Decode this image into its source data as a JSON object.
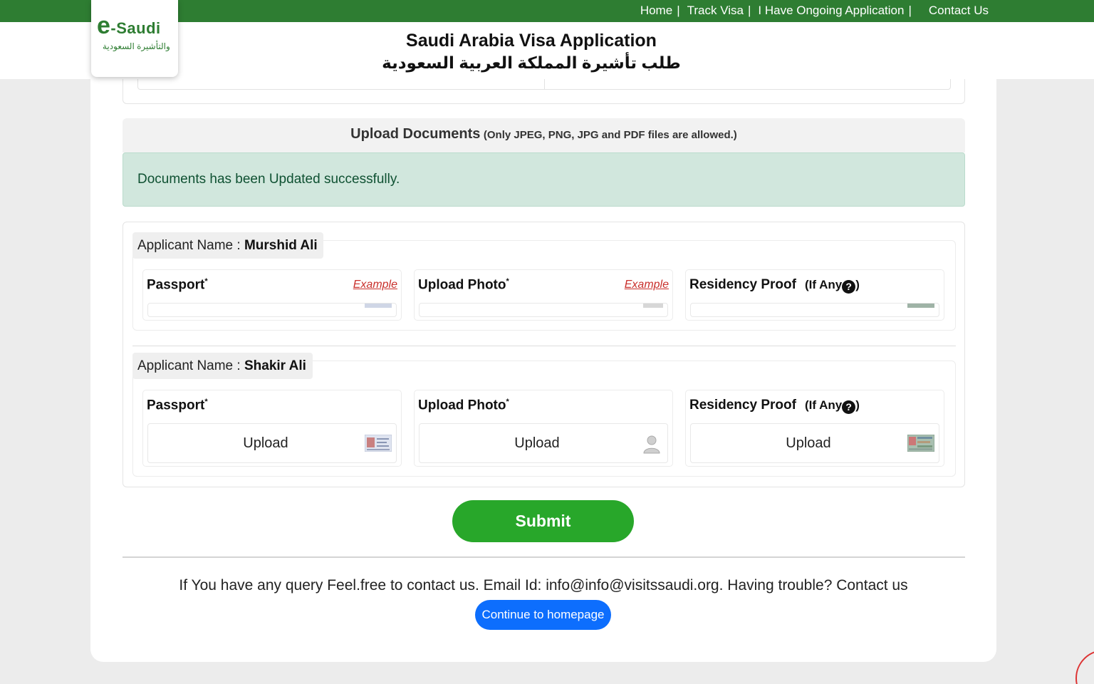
{
  "nav": {
    "home": "Home",
    "track": "Track Visa",
    "ongoing": "I Have Ongoing Application",
    "contact": "Contact Us",
    "sep": "|"
  },
  "logo": {
    "e": "e",
    "text": "-Saudi",
    "arabic": "والتأشيرة السعودية"
  },
  "header": {
    "title": "Saudi Arabia Visa Application",
    "title_ar": "طلب تأشيرة المملكة العربية السعودية"
  },
  "upload": {
    "heading": "Upload Documents",
    "note": "(Only JPEG, PNG, JPG and PDF files are allowed.)"
  },
  "alert": {
    "message": "Documents has been Updated successfully."
  },
  "applicants": [
    {
      "label": "Applicant Name : ",
      "name": "Murshid Ali",
      "docs": {
        "passport": {
          "label": "Passport",
          "req": "*",
          "example": "Example"
        },
        "photo": {
          "label": "Upload Photo",
          "req": "*",
          "example": "Example"
        },
        "residency": {
          "label": "Residency Proof",
          "ifany": "(If Any",
          "help": "?",
          "close": ")"
        }
      }
    },
    {
      "label": "Applicant Name : ",
      "name": "Shakir Ali",
      "docs": {
        "passport": {
          "label": "Passport",
          "req": "*",
          "upload": "Upload"
        },
        "photo": {
          "label": "Upload Photo",
          "req": "*",
          "upload": "Upload"
        },
        "residency": {
          "label": "Residency Proof",
          "ifany": "(If Any",
          "help": "?",
          "close": ")",
          "upload": "Upload"
        }
      }
    }
  ],
  "submit": "Submit",
  "footer": {
    "text": "If You have any query Feel.free to contact us. Email Id: info@info@visitssaudi.org. Having trouble? Contact us",
    "home_button": "Continue to homepage"
  },
  "colors": {
    "brand_green": "#2e7d32",
    "submit_green": "#28a72a",
    "alert_bg": "#d1e7dd",
    "alert_text": "#0f5132",
    "link_red": "#c9302c",
    "primary_blue": "#0d6efd"
  },
  "icons": {
    "passport_thumb": "passport-thumbnail-icon",
    "photo_thumb": "user-silhouette-icon",
    "residency_thumb": "residency-card-thumbnail-icon",
    "help": "question-circle-icon"
  }
}
